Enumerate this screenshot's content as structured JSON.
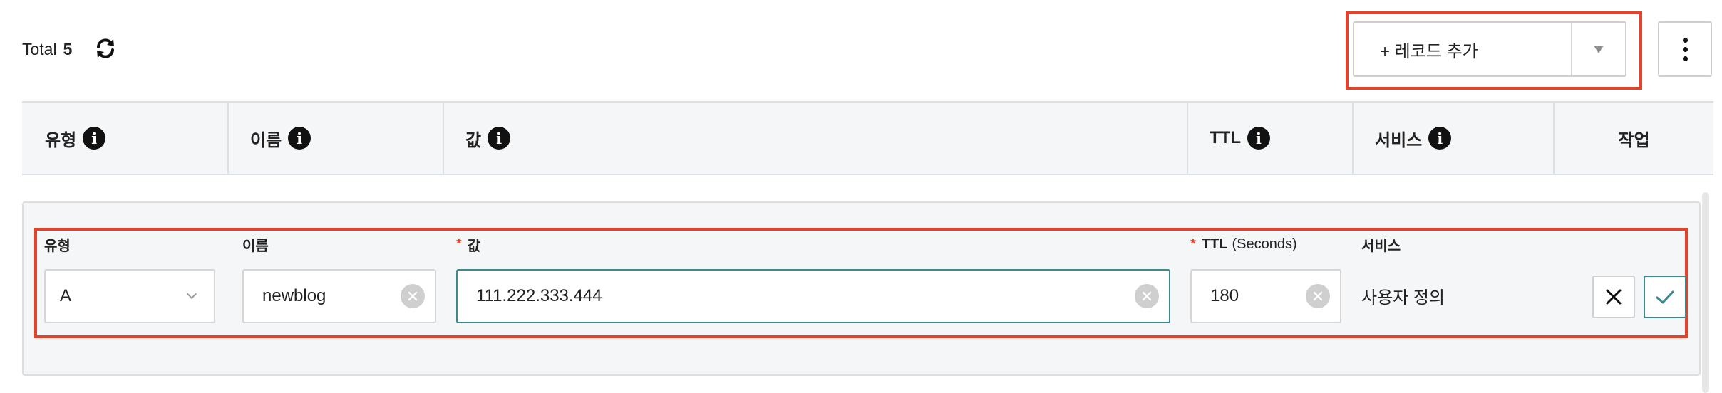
{
  "toolbar": {
    "total_label": "Total",
    "total_count": "5",
    "add_record_label": "+ 레코드 추가"
  },
  "table": {
    "headers": [
      {
        "label": "유형",
        "info": "i"
      },
      {
        "label": "이름",
        "info": "i"
      },
      {
        "label": "값",
        "info": "i"
      },
      {
        "label": "TTL",
        "info": "i"
      },
      {
        "label": "서비스",
        "info": "i"
      },
      {
        "label": "작업"
      }
    ]
  },
  "edit_row": {
    "type_label": "유형",
    "type_value": "A",
    "name_label": "이름",
    "name_value": "newblog",
    "value_required_mark": "*",
    "value_label": "값",
    "value_value": "111.222.333.444",
    "ttl_required_mark": "*",
    "ttl_label": "TTL",
    "ttl_unit": "(Seconds)",
    "ttl_value": "180",
    "service_label": "서비스",
    "service_value": "사용자 정의"
  },
  "colors": {
    "highlight": "#e3432b",
    "accent": "#3a8a8f",
    "header_bg": "#f5f6f7"
  }
}
